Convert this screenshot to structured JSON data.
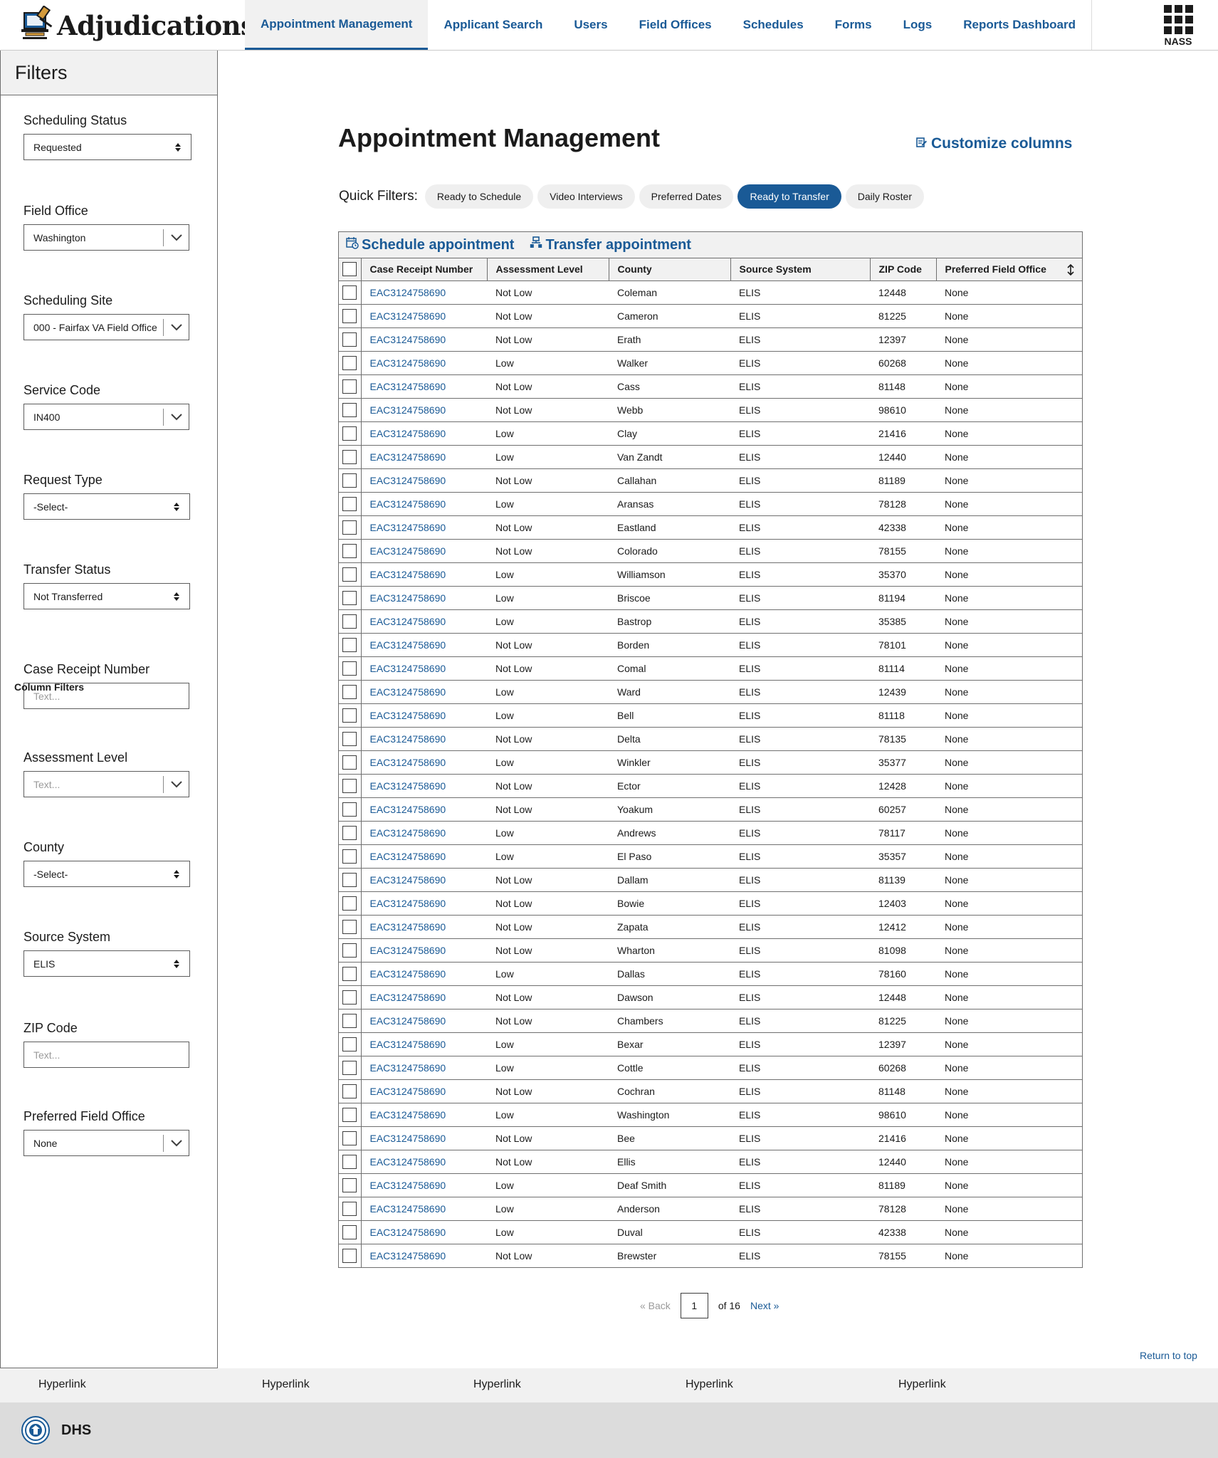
{
  "app": {
    "title": "Adjudications"
  },
  "nav": {
    "items": [
      {
        "label": "Appointment Management",
        "active": true
      },
      {
        "label": "Applicant Search"
      },
      {
        "label": "Users"
      },
      {
        "label": "Field Offices"
      },
      {
        "label": "Schedules"
      },
      {
        "label": "Forms"
      },
      {
        "label": "Logs"
      },
      {
        "label": "Reports Dashboard"
      }
    ],
    "apps_label": "NASS"
  },
  "sidebar": {
    "title": "Filters",
    "column_filters_title": "Column Filters",
    "filters": [
      {
        "label": "Scheduling Status",
        "value": "Requested",
        "control": "select"
      },
      {
        "label": "Field Office",
        "value": "Washington",
        "control": "combo"
      },
      {
        "label": "Scheduling Site",
        "value": "000 - Fairfax VA Field Office",
        "control": "combo"
      },
      {
        "label": "Service Code",
        "value": "IN400",
        "control": "combo"
      },
      {
        "label": "Request Type",
        "value": "-Select-",
        "control": "select"
      },
      {
        "label": "Transfer Status",
        "value": "Not Transferred",
        "control": "select"
      },
      {
        "label": "Case Receipt Number",
        "placeholder": "Text...",
        "control": "text"
      },
      {
        "label": "Assessment Level",
        "placeholder": "Text...",
        "control": "combo"
      },
      {
        "label": "County",
        "value": "-Select-",
        "control": "select"
      },
      {
        "label": "Source System",
        "value": "ELIS",
        "control": "select"
      },
      {
        "label": "ZIP Code",
        "placeholder": "Text...",
        "control": "text"
      },
      {
        "label": "Preferred Field Office",
        "value": "None",
        "control": "combo"
      }
    ]
  },
  "main": {
    "title": "Appointment Management",
    "customize_label": "Customize columns",
    "quick_filters_label": "Quick Filters:",
    "quick_filters": [
      {
        "label": "Ready to Schedule"
      },
      {
        "label": "Video Interviews"
      },
      {
        "label": "Preferred Dates"
      },
      {
        "label": "Ready to Transfer",
        "active": true
      },
      {
        "label": "Daily Roster"
      }
    ],
    "toolbar": {
      "schedule_label": "Schedule appointment",
      "transfer_label": "Transfer appointment"
    },
    "table": {
      "columns": [
        "Case Receipt Number",
        "Assessment Level",
        "County",
        "Source System",
        "ZIP Code",
        "Preferred Field Office"
      ],
      "rows": [
        [
          "EAC3124758690",
          "Not Low",
          "Coleman",
          "ELIS",
          "12448",
          "None"
        ],
        [
          "EAC3124758690",
          "Not Low",
          "Cameron",
          "ELIS",
          "81225",
          "None"
        ],
        [
          "EAC3124758690",
          "Not Low",
          "Erath",
          "ELIS",
          "12397",
          "None"
        ],
        [
          "EAC3124758690",
          "Low",
          "Walker",
          "ELIS",
          "60268",
          "None"
        ],
        [
          "EAC3124758690",
          "Not Low",
          "Cass",
          "ELIS",
          "81148",
          "None"
        ],
        [
          "EAC3124758690",
          "Not Low",
          "Webb",
          "ELIS",
          "98610",
          "None"
        ],
        [
          "EAC3124758690",
          "Low",
          "Clay",
          "ELIS",
          "21416",
          "None"
        ],
        [
          "EAC3124758690",
          "Low",
          "Van Zandt",
          "ELIS",
          "12440",
          "None"
        ],
        [
          "EAC3124758690",
          "Not Low",
          "Callahan",
          "ELIS",
          "81189",
          "None"
        ],
        [
          "EAC3124758690",
          "Low",
          "Aransas",
          "ELIS",
          "78128",
          "None"
        ],
        [
          "EAC3124758690",
          "Not Low",
          "Eastland",
          "ELIS",
          "42338",
          "None"
        ],
        [
          "EAC3124758690",
          "Not Low",
          "Colorado",
          "ELIS",
          "78155",
          "None"
        ],
        [
          "EAC3124758690",
          "Low",
          "Williamson",
          "ELIS",
          "35370",
          "None"
        ],
        [
          "EAC3124758690",
          "Low",
          "Briscoe",
          "ELIS",
          "81194",
          "None"
        ],
        [
          "EAC3124758690",
          "Low",
          "Bastrop",
          "ELIS",
          "35385",
          "None"
        ],
        [
          "EAC3124758690",
          "Not Low",
          "Borden",
          "ELIS",
          "78101",
          "None"
        ],
        [
          "EAC3124758690",
          "Not Low",
          "Comal",
          "ELIS",
          "81114",
          "None"
        ],
        [
          "EAC3124758690",
          "Low",
          "Ward",
          "ELIS",
          "12439",
          "None"
        ],
        [
          "EAC3124758690",
          "Low",
          "Bell",
          "ELIS",
          "81118",
          "None"
        ],
        [
          "EAC3124758690",
          "Not Low",
          "Delta",
          "ELIS",
          "78135",
          "None"
        ],
        [
          "EAC3124758690",
          "Low",
          "Winkler",
          "ELIS",
          "35377",
          "None"
        ],
        [
          "EAC3124758690",
          "Not Low",
          "Ector",
          "ELIS",
          "12428",
          "None"
        ],
        [
          "EAC3124758690",
          "Not Low",
          "Yoakum",
          "ELIS",
          "60257",
          "None"
        ],
        [
          "EAC3124758690",
          "Low",
          "Andrews",
          "ELIS",
          "78117",
          "None"
        ],
        [
          "EAC3124758690",
          "Low",
          "El Paso",
          "ELIS",
          "35357",
          "None"
        ],
        [
          "EAC3124758690",
          "Not Low",
          "Dallam",
          "ELIS",
          "81139",
          "None"
        ],
        [
          "EAC3124758690",
          "Not Low",
          "Bowie",
          "ELIS",
          "12403",
          "None"
        ],
        [
          "EAC3124758690",
          "Not Low",
          "Zapata",
          "ELIS",
          "12412",
          "None"
        ],
        [
          "EAC3124758690",
          "Not Low",
          "Wharton",
          "ELIS",
          "81098",
          "None"
        ],
        [
          "EAC3124758690",
          "Low",
          "Dallas",
          "ELIS",
          "78160",
          "None"
        ],
        [
          "EAC3124758690",
          "Not Low",
          "Dawson",
          "ELIS",
          "12448",
          "None"
        ],
        [
          "EAC3124758690",
          "Not Low",
          "Chambers",
          "ELIS",
          "81225",
          "None"
        ],
        [
          "EAC3124758690",
          "Low",
          "Bexar",
          "ELIS",
          "12397",
          "None"
        ],
        [
          "EAC3124758690",
          "Low",
          "Cottle",
          "ELIS",
          "60268",
          "None"
        ],
        [
          "EAC3124758690",
          "Not Low",
          "Cochran",
          "ELIS",
          "81148",
          "None"
        ],
        [
          "EAC3124758690",
          "Low",
          "Washington",
          "ELIS",
          "98610",
          "None"
        ],
        [
          "EAC3124758690",
          "Not Low",
          "Bee",
          "ELIS",
          "21416",
          "None"
        ],
        [
          "EAC3124758690",
          "Not Low",
          "Ellis",
          "ELIS",
          "12440",
          "None"
        ],
        [
          "EAC3124758690",
          "Low",
          "Deaf Smith",
          "ELIS",
          "81189",
          "None"
        ],
        [
          "EAC3124758690",
          "Low",
          "Anderson",
          "ELIS",
          "78128",
          "None"
        ],
        [
          "EAC3124758690",
          "Low",
          "Duval",
          "ELIS",
          "42338",
          "None"
        ],
        [
          "EAC3124758690",
          "Not Low",
          "Brewster",
          "ELIS",
          "78155",
          "None"
        ]
      ]
    },
    "pager": {
      "back_label": "« Back",
      "current_page": "1",
      "of_label": "of 16",
      "next_label": "Next »"
    },
    "return_top_label": "Return to top"
  },
  "footer": {
    "links": [
      "Hyperlink",
      "Hyperlink",
      "Hyperlink",
      "Hyperlink",
      "Hyperlink"
    ],
    "agency": "DHS"
  },
  "colors": {
    "accent": "#1a5a96",
    "panel": "#f1f1f1",
    "footer_bottom": "#dcdcdc"
  }
}
